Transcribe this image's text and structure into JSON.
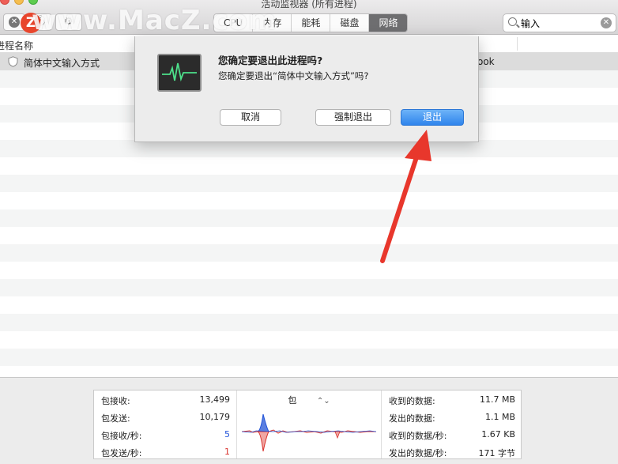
{
  "window": {
    "title": "活动监视器 (所有进程)"
  },
  "toolbar": {
    "stop_glyph": "✕",
    "info_glyph": "ⓘ",
    "gear_glyph": "⚙",
    "tabs": [
      {
        "label": "CPU",
        "active": false
      },
      {
        "label": "内存",
        "active": false
      },
      {
        "label": "能耗",
        "active": false
      },
      {
        "label": "磁盘",
        "active": false
      },
      {
        "label": "网络",
        "active": true
      }
    ],
    "search": {
      "value": "输入",
      "clear_glyph": "✕"
    }
  },
  "watermark": {
    "logo": "Z",
    "text": "www.MacZ.com"
  },
  "table": {
    "column_header": "进程名称",
    "rows": [
      {
        "name": "简体中文输入方式",
        "user": "ook",
        "selected": true
      }
    ]
  },
  "dialog": {
    "title": "您确定要退出此进程吗?",
    "message": "您确定要退出“简体中文输入方式”吗?",
    "cancel_label": "取消",
    "force_quit_label": "强制退出",
    "quit_label": "退出"
  },
  "stats": {
    "left": [
      {
        "label": "包接收:",
        "value": "13,499",
        "color": ""
      },
      {
        "label": "包发送:",
        "value": "10,179",
        "color": ""
      },
      {
        "label": "包接收/秒:",
        "value": "5",
        "color": "blue"
      },
      {
        "label": "包发送/秒:",
        "value": "1",
        "color": "red"
      }
    ],
    "graph_selector": "包",
    "graph_selector_chevron": "⌃⌄",
    "right": [
      {
        "label": "收到的数据:",
        "value": "11.7 MB"
      },
      {
        "label": "发出的数据:",
        "value": "1.1 MB"
      },
      {
        "label": "收到的数据/秒:",
        "value": "1.67 KB"
      },
      {
        "label": "发出的数据/秒:",
        "value": "171 字节"
      }
    ]
  },
  "colors": {
    "accent_blue": "#2f84ec",
    "incoming": "#2153d9",
    "outgoing": "#d9322d",
    "annotation_arrow": "#e8372c"
  }
}
